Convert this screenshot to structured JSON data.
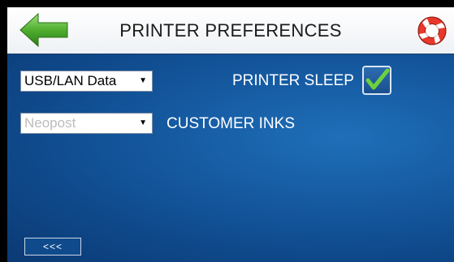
{
  "header": {
    "title": "PRINTER PREFERENCES",
    "back_icon": "left-arrow-icon",
    "help_icon": "life-ring-icon"
  },
  "settings": {
    "data_source": {
      "selected": "USB/LAN Data",
      "caret": "▼"
    },
    "ink_type": {
      "selected": "Neopost",
      "caret": "▼",
      "enabled": false
    },
    "printer_sleep": {
      "label": "PRINTER SLEEP",
      "checked": true
    },
    "customer_inks": {
      "label": "CUSTOMER INKS"
    }
  },
  "footer": {
    "back_label": "<<<"
  },
  "colors": {
    "accent_green": "#5dbb3a",
    "panel_blue": "#175ea6",
    "header_bg": "#ffffff"
  }
}
